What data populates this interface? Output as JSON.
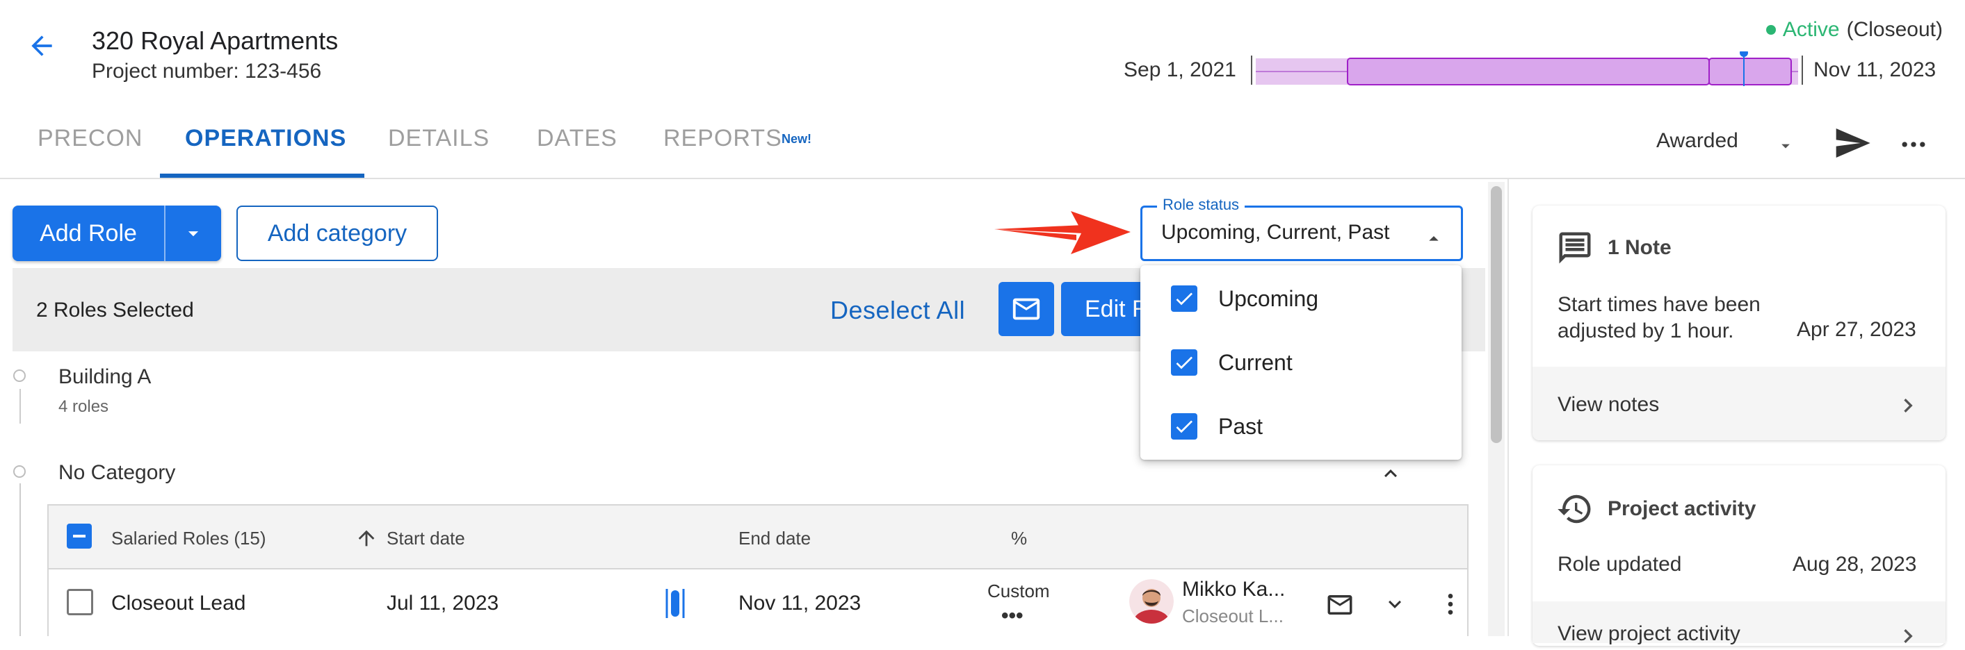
{
  "header": {
    "project_title": "320 Royal Apartments",
    "project_number": "Project number: 123-456",
    "status_active": "Active",
    "status_phase": "(Closeout)",
    "timeline_start": "Sep 1, 2021",
    "timeline_end": "Nov 11, 2023"
  },
  "tabs": [
    {
      "label": "PRECON"
    },
    {
      "label": "OPERATIONS"
    },
    {
      "label": "DETAILS"
    },
    {
      "label": "DATES"
    },
    {
      "label": "REPORTS"
    }
  ],
  "reports_badge": "New!",
  "active_tab": "OPERATIONS",
  "toolbar": {
    "stage_value": "Awarded",
    "add_role_label": "Add Role",
    "add_category_label": "Add category"
  },
  "selection": {
    "count_text": "2 Roles Selected",
    "deselect_label": "Deselect All",
    "edit_label": "Edit Roles"
  },
  "categories": {
    "building": {
      "name": "Building A",
      "count": "4 roles"
    },
    "none": {
      "name": "No Category"
    }
  },
  "table": {
    "headers": {
      "group": "Salaried Roles (15)",
      "start": "Start date",
      "end": "End date",
      "pct": "%"
    },
    "row": {
      "role": "Closeout Lead",
      "start": "Jul 11, 2023",
      "end": "Nov 11, 2023",
      "pct_label": "Custom",
      "pct_dots": "•••",
      "person_name": "Mikko Ka...",
      "person_sub": "Closeout L..."
    }
  },
  "role_status": {
    "label": "Role status",
    "value": "Upcoming, Current, Past",
    "options": [
      {
        "label": "Upcoming",
        "checked": true
      },
      {
        "label": "Current",
        "checked": true
      },
      {
        "label": "Past",
        "checked": true
      }
    ]
  },
  "notes_card": {
    "title": "1 Note",
    "text": "Start times have been adjusted by 1 hour.",
    "date": "Apr 27, 2023",
    "link": "View notes"
  },
  "activity_card": {
    "title": "Project activity",
    "row_text": "Role updated",
    "row_date": "Aug 28, 2023",
    "link": "View project activity"
  },
  "colors": {
    "primary": "#1a73e8",
    "active_green": "#2bb673",
    "timeline_purple": "#a020c8",
    "arrow_red": "#f0321e"
  },
  "icons": [
    "back-arrow-icon",
    "caret-down-icon",
    "send-icon",
    "more-vert-icon",
    "mail-icon",
    "chevron-up-icon",
    "chevron-down-icon",
    "check-icon",
    "note-icon",
    "history-icon",
    "chevron-right-icon"
  ]
}
